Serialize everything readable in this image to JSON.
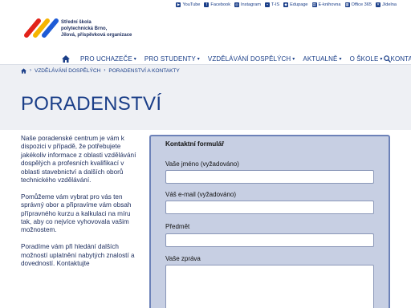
{
  "school": {
    "line1": "Střední škola",
    "line2": "polytechnická Brno,",
    "line3": "Jílová, příspěvková organizace"
  },
  "toplinks": [
    {
      "icon": "youtube-icon",
      "label": "YouTube"
    },
    {
      "icon": "facebook-icon",
      "label": "Facebook"
    },
    {
      "icon": "instagram-icon",
      "label": "Instagram"
    },
    {
      "icon": "tis-icon",
      "label": "T-IS"
    },
    {
      "icon": "edupage-icon",
      "label": "Edupage"
    },
    {
      "icon": "ebook-icon",
      "label": "E-knihovna"
    },
    {
      "icon": "office-icon",
      "label": "Office 365"
    },
    {
      "icon": "canteen-icon",
      "label": "Jídelna"
    }
  ],
  "nav": {
    "items": [
      {
        "label": "PRO UCHAZEČE",
        "dropdown": true
      },
      {
        "label": "PRO STUDENTY",
        "dropdown": true
      },
      {
        "label": "VZDĚLÁVÁNÍ DOSPĚLÝCH",
        "dropdown": true
      },
      {
        "label": "AKTUALNĚ",
        "dropdown": true
      },
      {
        "label": "O ŠKOLE",
        "dropdown": true
      },
      {
        "label": "KONTAKTY",
        "dropdown": false
      }
    ]
  },
  "breadcrumb": {
    "items": [
      "VZDĚLÁVÁNÍ DOSPĚLÝCH",
      "PORADENSTVÍ A KONTAKTY"
    ]
  },
  "page": {
    "title": "PORADENSTVÍ"
  },
  "content": {
    "paragraphs": [
      "Naše poradenské centrum je vám k dispozici v případě, že potřebujete jakékoliv informace z oblasti vzdělávání dospělých a profesních kvalifikací v oblasti stavebnictví a dalších oborů technického vzdělávání.",
      "Pomůžeme vám vybrat pro vás ten správný obor a připravíme vám obsah přípravného kurzu a kalkulaci na míru tak, aby co nejvíce vyhovovala vašim možnostem.",
      "Poradíme vám při hledání dalších možností uplatnění nabytých znalostí a dovedností. Kontaktujte"
    ]
  },
  "form": {
    "title": "Kontaktní formulář",
    "name_label": "Vaše jméno (vyžadováno)",
    "email_label": "Váš e-mail (vyžadováno)",
    "subject_label": "Předmět",
    "message_label": "Vaše zpráva"
  },
  "colors": {
    "brand": "#1a3e88",
    "logo_red": "#e2231a",
    "logo_yellow": "#f5b400",
    "logo_blue": "#1e5bd6",
    "form_bg": "#c7cfe3",
    "form_border": "#6d82b8"
  }
}
